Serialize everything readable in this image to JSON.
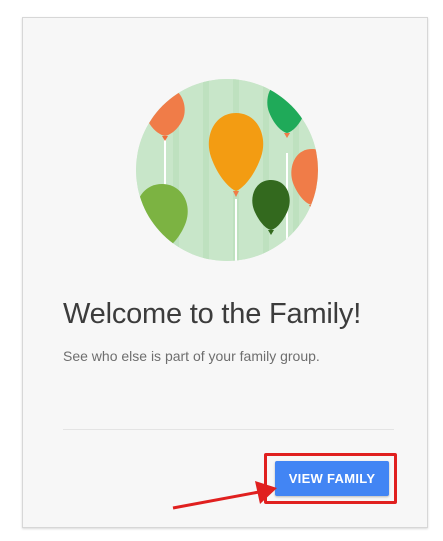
{
  "card": {
    "title": "Welcome to the Family!",
    "description": "See who else is part of your family group.",
    "view_family_label": "VIEW FAMILY"
  },
  "illustration": {
    "icon": "balloons-icon",
    "colors": {
      "background": "#c8e6c9",
      "balloon_orange": "#f07c48",
      "balloon_amber": "#f39c12",
      "balloon_green": "#1faa59",
      "balloon_light_green": "#7cb342",
      "balloon_dark_green": "#33691e"
    }
  },
  "annotation": {
    "highlight_color": "#e0201f",
    "arrow_icon": "red-arrow-icon"
  },
  "colors": {
    "button": "#4285f4",
    "title_text": "#3c3c3c",
    "subtitle_text": "#6e6e6e"
  }
}
